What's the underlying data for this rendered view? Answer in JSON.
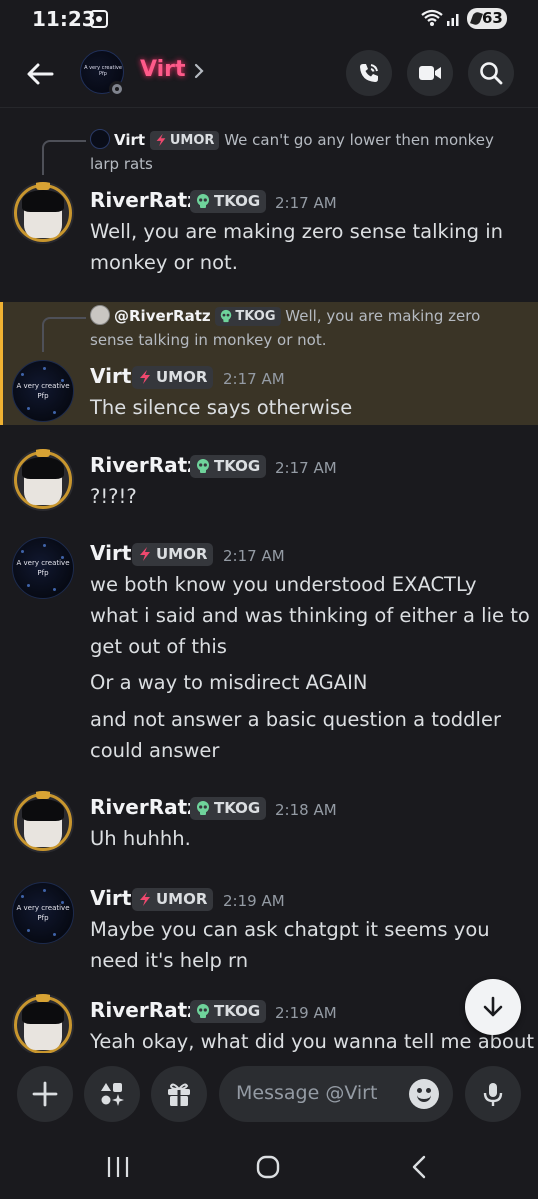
{
  "status": {
    "time": "11:23",
    "battery": "63"
  },
  "header": {
    "name": "Virt",
    "avatar_text": "A very creative Pfp"
  },
  "messages": [
    {
      "reply": {
        "name": "Virt",
        "tag": "UMOR",
        "text": "We can't go any lower then monkey larp rats"
      },
      "user": "RiverRatz",
      "tag": "TKOG",
      "time": "2:17 AM",
      "lines": [
        "Well, you are making zero sense talking in monkey or not."
      ]
    },
    {
      "reply": {
        "name": "@RiverRatz",
        "tag": "TKOG",
        "text": "Well, you are making zero sense talking in monkey or not."
      },
      "user": "Virt",
      "tag": "UMOR",
      "time": "2:17 AM",
      "lines": [
        "The silence says otherwise"
      ]
    },
    {
      "user": "RiverRatz",
      "tag": "TKOG",
      "time": "2:17 AM",
      "lines": [
        "?!?!?"
      ]
    },
    {
      "user": "Virt",
      "tag": "UMOR",
      "time": "2:17 AM",
      "lines": [
        "we both know you understood EXACTLy what i said and was thinking of either a lie to get out of this",
        "Or a way to misdirect AGAIN",
        "and not answer a basic question a toddler could answer"
      ]
    },
    {
      "user": "RiverRatz",
      "tag": "TKOG",
      "time": "2:18 AM",
      "lines": [
        "Uh huhhh."
      ]
    },
    {
      "user": "Virt",
      "tag": "UMOR",
      "time": "2:19 AM",
      "lines": [
        "Maybe you can ask chatgpt it seems you need it's help rn"
      ]
    },
    {
      "user": "RiverRatz",
      "tag": "TKOG",
      "time": "2:19 AM",
      "lines": [
        "Yeah okay, what did you wanna tell me about"
      ]
    }
  ],
  "composer": {
    "placeholder": "Message @Virt"
  },
  "colors": {
    "virt_name": "#ff5a8a",
    "highlight": "#3a3426",
    "highlight_bar": "#f0b232",
    "tkog_icon": "#6fd39b",
    "umor_icon": "#f0486e"
  },
  "icons": [
    "back-arrow-icon",
    "chevron-right-icon",
    "voice-call-icon",
    "video-call-icon",
    "search-icon",
    "skull-icon",
    "lightning-icon",
    "arrow-down-icon",
    "plus-icon",
    "apps-icon",
    "gift-icon",
    "emoji-icon",
    "microphone-icon",
    "recents-icon",
    "home-icon",
    "back-nav-icon"
  ]
}
